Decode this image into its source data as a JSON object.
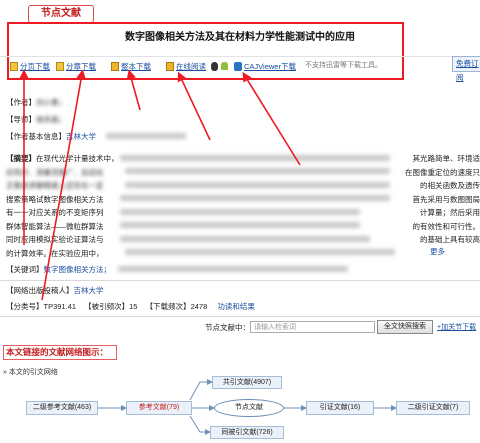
{
  "section_tag": "节点文献",
  "document": {
    "title": "数字图像相关方法及其在材料力学性能测试中的应用"
  },
  "toolbar": {
    "page_download": "分页下载",
    "chapter_download": "分章下载",
    "full_download": "整本下载",
    "online_read": "在线阅读",
    "cajviewer_download": "CAJViewer下载",
    "thunder_note": "不支持迅雷等下载工具。",
    "free_subscribe": "免费订阅"
  },
  "meta": {
    "author_label": "【作者】",
    "author_value": "刘小勇；",
    "advisor_label": "【导师】",
    "advisor_value": "徐庆昌；",
    "author_info_label": "【作者基本信息】",
    "author_info_value": "吉林大学",
    "abstract_label": "【摘要】",
    "abstract_line1": "在现代光学计量技术中，",
    "abstract_line1_end": "其光路简单、环境适",
    "abstract_line2": "应性好、测量范围广、自动化",
    "abstract_line2_end": "在图像重定位的速度只",
    "abstract_line3": "正像素求解精度上还存在一定",
    "abstract_line3_end": "的相关函数及遗传",
    "abstract_line4": "搜索策略试数字图像相关方法",
    "abstract_line4_end": "首先采用与数图图局",
    "abstract_line5": "有一一对应关系的不变矩序列",
    "abstract_line5_end": "计算量；然后采用",
    "abstract_line6": "群体智能算法——微粒群算法",
    "abstract_line6_end": "的有效性和可行性。",
    "abstract_line7": "同时应用模拟实验论证算法与",
    "abstract_line7_end": "的基础上具有较高",
    "abstract_line8": "的计算效率。在实验应用中，",
    "more_link": "更多",
    "keywords_label": "【关键词】",
    "keywords_first": "数字图像相关方法；",
    "publisher_label": "【网络出版投稿人】",
    "publisher_value": "吉林大学",
    "class_label": "【分类号】",
    "class_value": "TP391.41",
    "cited_label": "【被引频次】",
    "cited_value": "15",
    "downloads_label": "【下载频次】",
    "downloads_value": "2478",
    "function_link": "功读和结果"
  },
  "search": {
    "label": "节点文献中：",
    "placeholder": "请输入检索词",
    "button": "全文快照搜索",
    "attention_link": "+加关节下载"
  },
  "network": {
    "title": "本文链接的文献网络图示：",
    "subtitle": "» 本文的引文网络",
    "nodes": {
      "secondary_refs": "二级参考文献(463)",
      "refs": "参考文献(79)",
      "node_doc": "节点文献",
      "citing": "引证文献(16)",
      "secondary_citing": "二级引证文献(7)",
      "co_cited": "共引文献(4907)",
      "co_citing": "同被引文献(726)"
    }
  },
  "colors": {
    "annotation_red": "#ee1b24",
    "link_blue": "#1a4ea0"
  }
}
